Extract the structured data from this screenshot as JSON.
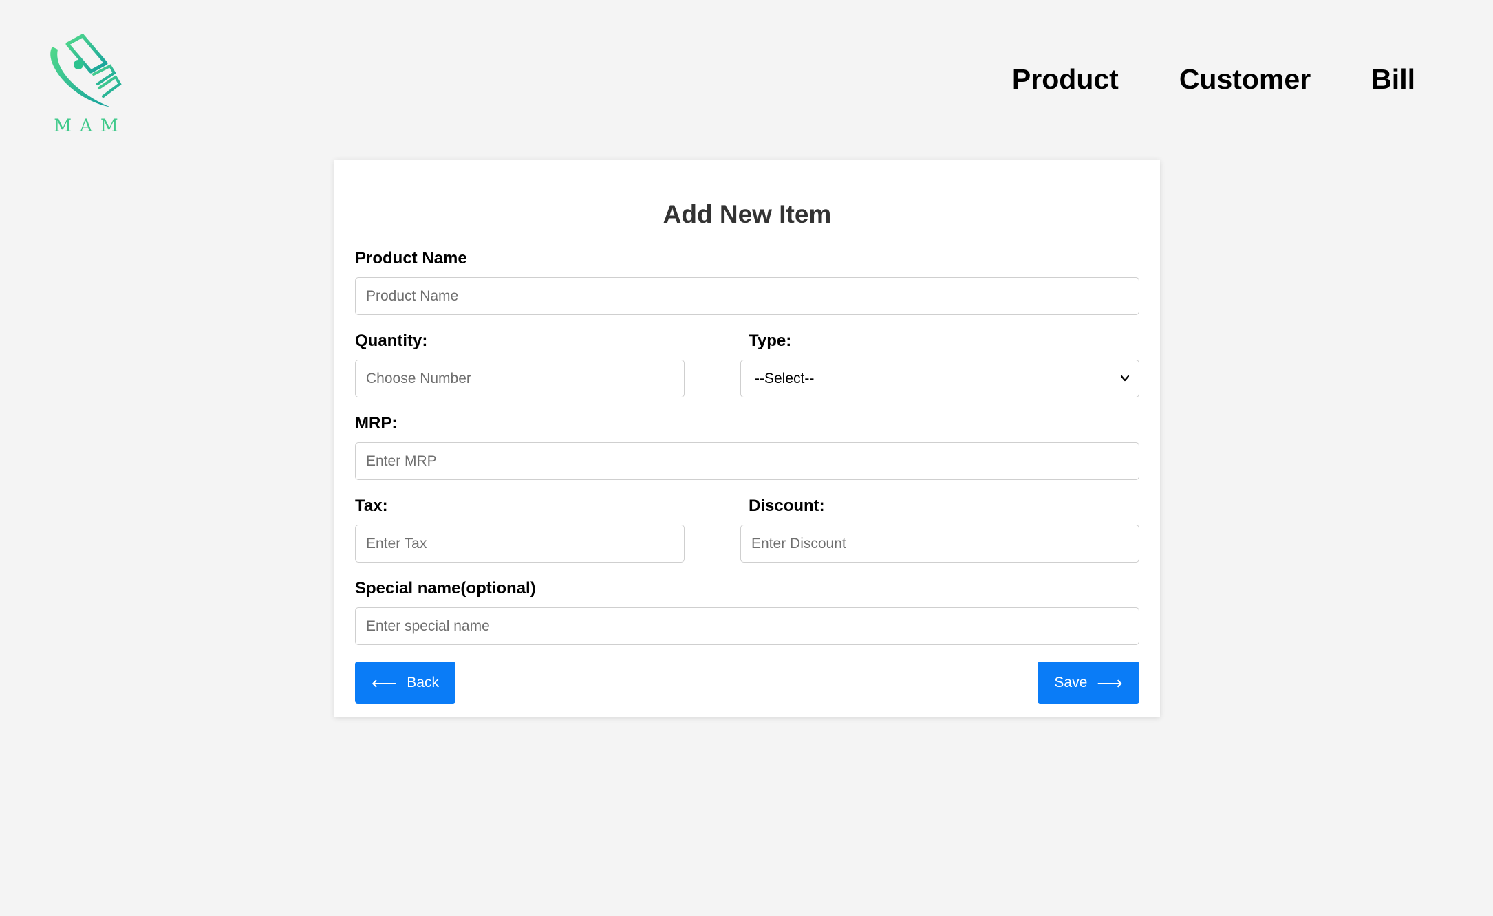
{
  "brand": {
    "logo_text": "MAM",
    "colors": {
      "logo_green": "#3fc98a",
      "logo_teal": "#17a39a"
    },
    "icon": "money-bills-logo-icon"
  },
  "nav": {
    "items": [
      {
        "label": "Product"
      },
      {
        "label": "Customer"
      },
      {
        "label": "Bill"
      }
    ]
  },
  "form": {
    "title": "Add New Item",
    "product_name": {
      "label": "Product Name",
      "placeholder": "Product Name",
      "value": ""
    },
    "quantity": {
      "label": "Quantity:",
      "placeholder": "Choose Number",
      "value": ""
    },
    "type": {
      "label": "Type:",
      "selected": "--Select--"
    },
    "mrp": {
      "label": "MRP:",
      "placeholder": "Enter MRP",
      "value": ""
    },
    "tax": {
      "label": "Tax:",
      "placeholder": "Enter Tax",
      "value": ""
    },
    "discount": {
      "label": "Discount:",
      "placeholder": "Enter Discount",
      "value": ""
    },
    "special_name": {
      "label": "Special name(optional)",
      "placeholder": "Enter special name",
      "value": ""
    },
    "back_button": {
      "label": "Back",
      "icon": "arrow-left-icon"
    },
    "save_button": {
      "label": "Save",
      "icon": "arrow-right-icon"
    },
    "accent_color": "#0a7cf7"
  }
}
